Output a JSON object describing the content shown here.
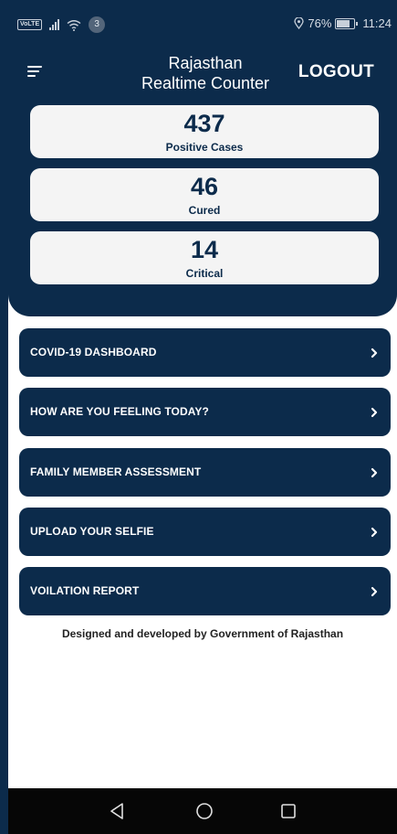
{
  "status_bar": {
    "volte": "VoLTE",
    "notification_count": "3",
    "battery": "76%",
    "time": "11:24"
  },
  "app_bar": {
    "title_line1": "Rajasthan",
    "title_line2": "Realtime Counter",
    "logout_label": "LOGOUT",
    "menu_icon": "hamburger-menu-icon"
  },
  "stats": [
    {
      "value": "437",
      "label": "Positive Cases"
    },
    {
      "value": "46",
      "label": "Cured"
    },
    {
      "value": "14",
      "label": "Critical"
    }
  ],
  "menu": [
    {
      "label": "COVID-19 DASHBOARD"
    },
    {
      "label": "HOW ARE YOU FEELING TODAY?"
    },
    {
      "label": "FAMILY MEMBER ASSESSMENT"
    },
    {
      "label": "UPLOAD YOUR SELFIE"
    },
    {
      "label": "VOILATION REPORT"
    }
  ],
  "footer": "Designed and developed by Government of Rajasthan",
  "nav": {
    "back_icon": "back-triangle-icon",
    "home_icon": "home-circle-icon",
    "recents_icon": "recents-square-icon"
  },
  "colors": {
    "primary": "#0c2b4b",
    "card": "#f4f4f4",
    "nav_bar": "#060606"
  }
}
